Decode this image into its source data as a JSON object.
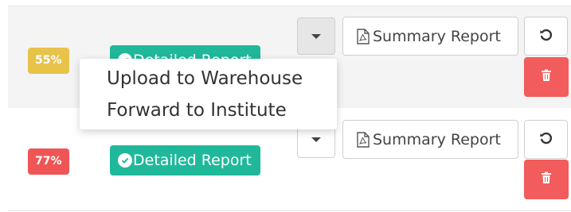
{
  "colors": {
    "badge_yellow": "#e8c34a",
    "badge_red": "#ef5555",
    "teal": "#20b89a",
    "delete_red": "#f25c5c"
  },
  "rows": [
    {
      "percent": "55%",
      "detailed_label": "Detailed Report",
      "summary_label": "Summary Report",
      "icons": {
        "check": "check-circle-icon",
        "caret": "caret-down-icon",
        "pdf": "file-pdf-icon",
        "reload": "reload-icon",
        "delete": "trash-icon"
      }
    },
    {
      "percent": "77%",
      "detailed_label": "Detailed Report",
      "summary_label": "Summary Report",
      "icons": {
        "check": "check-circle-icon",
        "caret": "caret-down-icon",
        "pdf": "file-pdf-icon",
        "reload": "reload-icon",
        "delete": "trash-icon"
      }
    }
  ],
  "dropdown": {
    "items": [
      "Upload to Warehouse",
      "Forward to Institute"
    ]
  }
}
